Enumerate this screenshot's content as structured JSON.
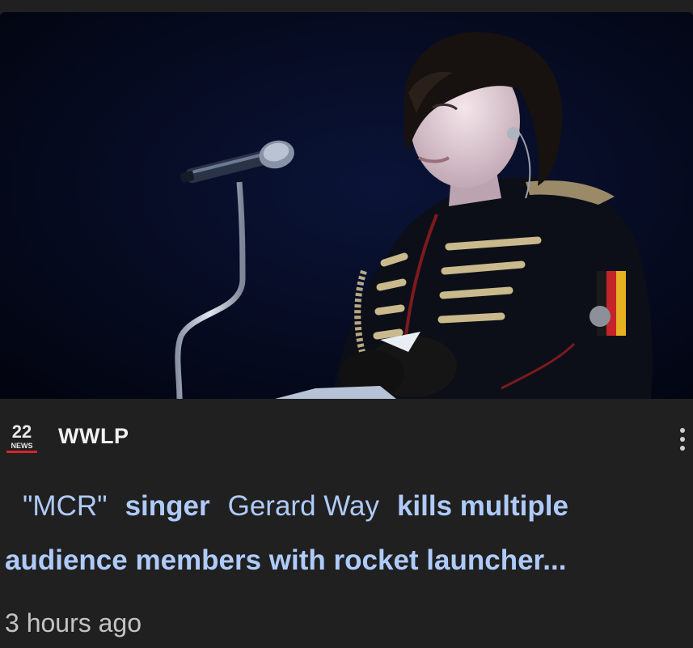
{
  "source": {
    "logo_text_top": "22",
    "logo_text_bottom": "NEWS",
    "name": "WWLP",
    "menu_icon": "more-vert-icon"
  },
  "headline": {
    "part1": "\"MCR\"",
    "part2": "singer",
    "part3": "Gerard Way",
    "part4": "kills multiple",
    "part5": "audience members with rocket launcher..."
  },
  "timestamp": "3 hours ago",
  "colors": {
    "background": "#202020",
    "headline": "#aecbfa",
    "source_name": "#f1f1f1",
    "timestamp": "#c4c4c4",
    "logo_red": "#d6242b"
  }
}
